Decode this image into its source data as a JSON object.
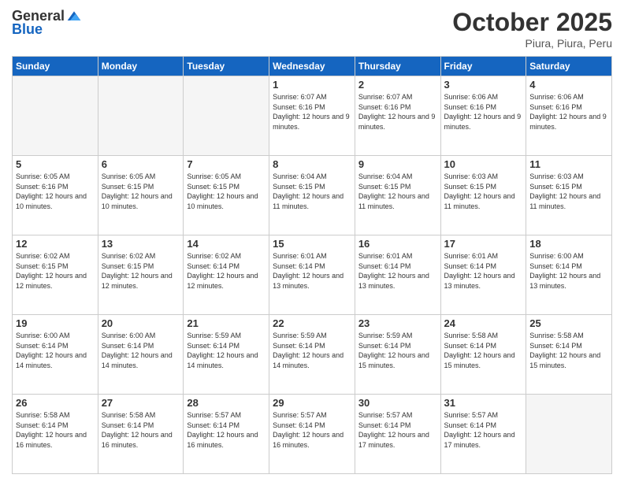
{
  "logo": {
    "general": "General",
    "blue": "Blue"
  },
  "header": {
    "month": "October 2025",
    "location": "Piura, Piura, Peru"
  },
  "days_of_week": [
    "Sunday",
    "Monday",
    "Tuesday",
    "Wednesday",
    "Thursday",
    "Friday",
    "Saturday"
  ],
  "weeks": [
    [
      {
        "day": "",
        "info": ""
      },
      {
        "day": "",
        "info": ""
      },
      {
        "day": "",
        "info": ""
      },
      {
        "day": "1",
        "info": "Sunrise: 6:07 AM\nSunset: 6:16 PM\nDaylight: 12 hours and 9 minutes."
      },
      {
        "day": "2",
        "info": "Sunrise: 6:07 AM\nSunset: 6:16 PM\nDaylight: 12 hours and 9 minutes."
      },
      {
        "day": "3",
        "info": "Sunrise: 6:06 AM\nSunset: 6:16 PM\nDaylight: 12 hours and 9 minutes."
      },
      {
        "day": "4",
        "info": "Sunrise: 6:06 AM\nSunset: 6:16 PM\nDaylight: 12 hours and 9 minutes."
      }
    ],
    [
      {
        "day": "5",
        "info": "Sunrise: 6:05 AM\nSunset: 6:16 PM\nDaylight: 12 hours and 10 minutes."
      },
      {
        "day": "6",
        "info": "Sunrise: 6:05 AM\nSunset: 6:15 PM\nDaylight: 12 hours and 10 minutes."
      },
      {
        "day": "7",
        "info": "Sunrise: 6:05 AM\nSunset: 6:15 PM\nDaylight: 12 hours and 10 minutes."
      },
      {
        "day": "8",
        "info": "Sunrise: 6:04 AM\nSunset: 6:15 PM\nDaylight: 12 hours and 11 minutes."
      },
      {
        "day": "9",
        "info": "Sunrise: 6:04 AM\nSunset: 6:15 PM\nDaylight: 12 hours and 11 minutes."
      },
      {
        "day": "10",
        "info": "Sunrise: 6:03 AM\nSunset: 6:15 PM\nDaylight: 12 hours and 11 minutes."
      },
      {
        "day": "11",
        "info": "Sunrise: 6:03 AM\nSunset: 6:15 PM\nDaylight: 12 hours and 11 minutes."
      }
    ],
    [
      {
        "day": "12",
        "info": "Sunrise: 6:02 AM\nSunset: 6:15 PM\nDaylight: 12 hours and 12 minutes."
      },
      {
        "day": "13",
        "info": "Sunrise: 6:02 AM\nSunset: 6:15 PM\nDaylight: 12 hours and 12 minutes."
      },
      {
        "day": "14",
        "info": "Sunrise: 6:02 AM\nSunset: 6:14 PM\nDaylight: 12 hours and 12 minutes."
      },
      {
        "day": "15",
        "info": "Sunrise: 6:01 AM\nSunset: 6:14 PM\nDaylight: 12 hours and 13 minutes."
      },
      {
        "day": "16",
        "info": "Sunrise: 6:01 AM\nSunset: 6:14 PM\nDaylight: 12 hours and 13 minutes."
      },
      {
        "day": "17",
        "info": "Sunrise: 6:01 AM\nSunset: 6:14 PM\nDaylight: 12 hours and 13 minutes."
      },
      {
        "day": "18",
        "info": "Sunrise: 6:00 AM\nSunset: 6:14 PM\nDaylight: 12 hours and 13 minutes."
      }
    ],
    [
      {
        "day": "19",
        "info": "Sunrise: 6:00 AM\nSunset: 6:14 PM\nDaylight: 12 hours and 14 minutes."
      },
      {
        "day": "20",
        "info": "Sunrise: 6:00 AM\nSunset: 6:14 PM\nDaylight: 12 hours and 14 minutes."
      },
      {
        "day": "21",
        "info": "Sunrise: 5:59 AM\nSunset: 6:14 PM\nDaylight: 12 hours and 14 minutes."
      },
      {
        "day": "22",
        "info": "Sunrise: 5:59 AM\nSunset: 6:14 PM\nDaylight: 12 hours and 14 minutes."
      },
      {
        "day": "23",
        "info": "Sunrise: 5:59 AM\nSunset: 6:14 PM\nDaylight: 12 hours and 15 minutes."
      },
      {
        "day": "24",
        "info": "Sunrise: 5:58 AM\nSunset: 6:14 PM\nDaylight: 12 hours and 15 minutes."
      },
      {
        "day": "25",
        "info": "Sunrise: 5:58 AM\nSunset: 6:14 PM\nDaylight: 12 hours and 15 minutes."
      }
    ],
    [
      {
        "day": "26",
        "info": "Sunrise: 5:58 AM\nSunset: 6:14 PM\nDaylight: 12 hours and 16 minutes."
      },
      {
        "day": "27",
        "info": "Sunrise: 5:58 AM\nSunset: 6:14 PM\nDaylight: 12 hours and 16 minutes."
      },
      {
        "day": "28",
        "info": "Sunrise: 5:57 AM\nSunset: 6:14 PM\nDaylight: 12 hours and 16 minutes."
      },
      {
        "day": "29",
        "info": "Sunrise: 5:57 AM\nSunset: 6:14 PM\nDaylight: 12 hours and 16 minutes."
      },
      {
        "day": "30",
        "info": "Sunrise: 5:57 AM\nSunset: 6:14 PM\nDaylight: 12 hours and 17 minutes."
      },
      {
        "day": "31",
        "info": "Sunrise: 5:57 AM\nSunset: 6:14 PM\nDaylight: 12 hours and 17 minutes."
      },
      {
        "day": "",
        "info": ""
      }
    ]
  ]
}
